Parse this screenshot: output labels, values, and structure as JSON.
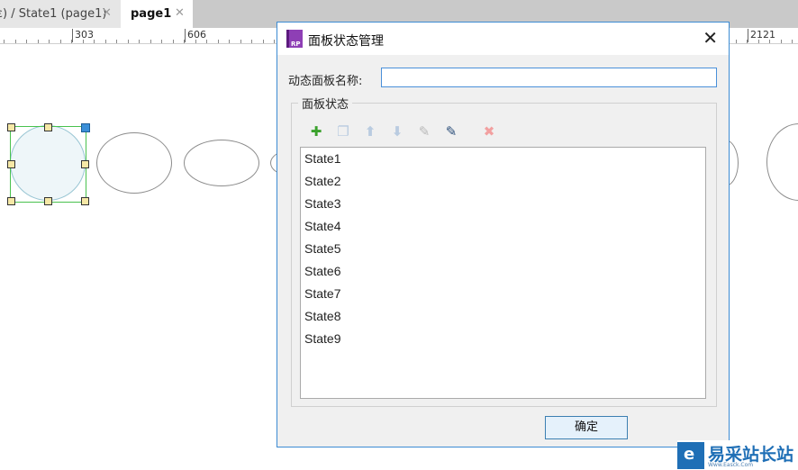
{
  "tabs": [
    {
      "label": "ε) / State1 (page1)",
      "close": "✕",
      "active": false
    },
    {
      "label": "page1",
      "close": "✕",
      "active": true
    }
  ],
  "ruler": {
    "labels": [
      "303",
      "606",
      "2121"
    ]
  },
  "dialog": {
    "title": "面板状态管理",
    "close": "✕",
    "name_label": "动态面板名称:",
    "name_value": "",
    "group_label": "面板状态",
    "toolbar": [
      {
        "icon": "add-icon",
        "glyph": "✚",
        "color": "#3aa12c",
        "enabled": true
      },
      {
        "icon": "duplicate-icon",
        "glyph": "❐",
        "color": "#b9cbe0",
        "enabled": false
      },
      {
        "icon": "move-up-icon",
        "glyph": "⬆",
        "color": "#b9cbe0",
        "enabled": false
      },
      {
        "icon": "move-down-icon",
        "glyph": "⬇",
        "color": "#b9cbe0",
        "enabled": false
      },
      {
        "icon": "edit-state-icon",
        "glyph": "✎",
        "color": "#b9b9b9",
        "enabled": false
      },
      {
        "icon": "edit-all-icon",
        "glyph": "✎",
        "color": "#2c4f7a",
        "enabled": true
      },
      {
        "icon": "delete-icon",
        "glyph": "✖",
        "color": "#f2a0a0",
        "enabled": false
      }
    ],
    "states": [
      "State1",
      "State2",
      "State3",
      "State4",
      "State5",
      "State6",
      "State7",
      "State8",
      "State9"
    ],
    "ok_label": "确定"
  },
  "watermark": {
    "text": "易采站长站",
    "sub": "Www.Easck.Com"
  },
  "colors": {
    "accent": "#3c8bd3",
    "selection": "#49c24e",
    "handle": "#f6e8a6"
  }
}
